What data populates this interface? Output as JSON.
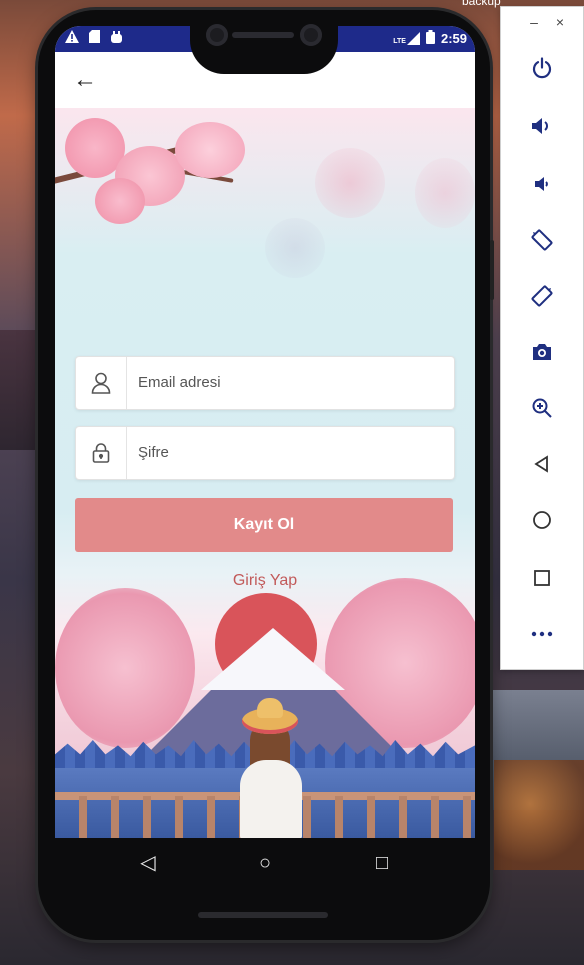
{
  "desktop": {
    "backup_label": "backup"
  },
  "status_bar": {
    "time": "2:59",
    "lte": "LTE"
  },
  "app_bar": {
    "back_label": "←"
  },
  "form": {
    "email_placeholder": "Email adresi",
    "password_placeholder": "Şifre",
    "register_label": "Kayıt Ol",
    "login_label": "Giriş Yap"
  },
  "nav_bar": {
    "back": "◁",
    "home": "○",
    "recents": "□"
  },
  "emulator_panel": {
    "minimize": "–",
    "close": "×",
    "buttons": [
      "power",
      "volume-up",
      "volume-down",
      "rotate-left",
      "rotate-right",
      "screenshot",
      "zoom",
      "back",
      "home",
      "overview",
      "more"
    ]
  },
  "colors": {
    "status_bar": "#1e2a8a",
    "accent": "#e28a8a",
    "link": "#c25a5a",
    "emulator_icon": "#1f2f80"
  }
}
